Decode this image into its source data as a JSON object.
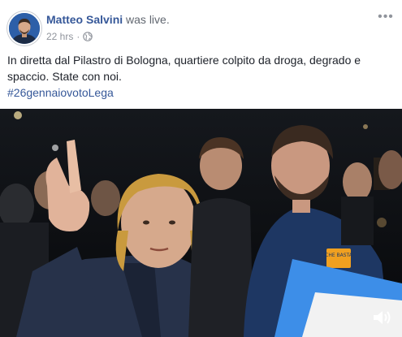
{
  "post": {
    "author_name": "Matteo Salvini",
    "author_action": "was live.",
    "timestamp": "22 hrs",
    "separator": "·",
    "privacy_icon": "globe-icon",
    "more_icon": "more-options-icon",
    "text": "In diretta dal Pilastro di Bologna, quartiere colpito da droga, degrado e spaccio. State con noi.",
    "hashtag": "#26gennaiovotoLega"
  },
  "video": {
    "volume_icon": "speaker-volume-icon",
    "badge_text": "CHE BASTA"
  },
  "colors": {
    "link": "#365899",
    "meta": "#90949c",
    "body_text": "#1d2129"
  }
}
